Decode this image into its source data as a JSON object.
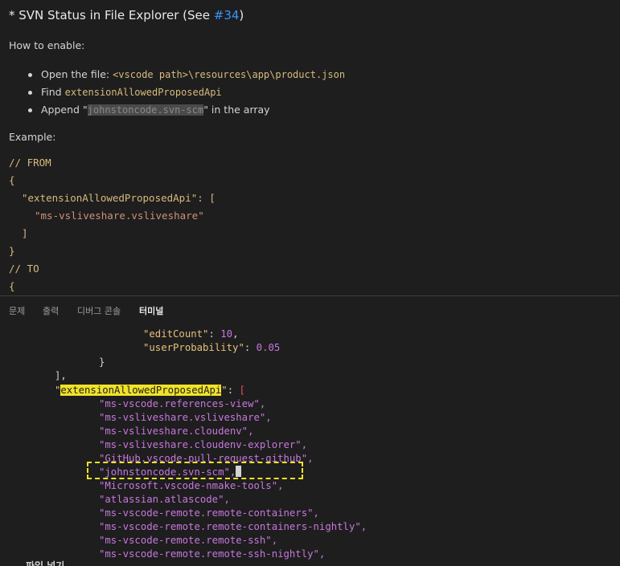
{
  "preview": {
    "heading_prefix": "* SVN Status in File Explorer (See ",
    "heading_link": "#34",
    "heading_suffix": ")",
    "how_to_enable": "How to enable:",
    "steps": [
      {
        "text": "Open the file: ",
        "code": "<vscode path>\\resources\\app\\product.json"
      },
      {
        "text": "Find ",
        "code": "extensionAllowedProposedApi"
      },
      {
        "text_before": "Append \"",
        "code": "johnstoncode.svn-scm",
        "text_after": "\" in the array"
      }
    ],
    "example_label": "Example:",
    "code": {
      "from_comment": "// FROM",
      "open_brace": "{",
      "key_line": "\"extensionAllowedProposedApi\": [",
      "value_line": "\"ms-vsliveshare.vsliveshare\"",
      "close_bracket": "]",
      "close_brace": "}",
      "to_comment": "// TO",
      "open_brace2": "{"
    }
  },
  "panel": {
    "tabs": [
      {
        "label": "문제"
      },
      {
        "label": "출력"
      },
      {
        "label": "디버그 콘솔"
      },
      {
        "label": "터미널",
        "active": true
      }
    ],
    "terminal": {
      "edit_count_key": "\"editCount\"",
      "edit_count_value": "10",
      "user_prob_key": "\"userProbability\"",
      "user_prob_value": "0.05",
      "close_brace": "}",
      "close_bracket": "],",
      "api_key": "extensionAllowedProposedApi",
      "api_open": "[",
      "items": [
        "\"ms-vscode.references-view\",",
        "\"ms-vsliveshare.vsliveshare\",",
        "\"ms-vsliveshare.cloudenv\",",
        "\"ms-vsliveshare.cloudenv-explorer\",",
        "\"GitHub.vscode-pull-request-github\",",
        "\"johnstoncode.svn-scm\",",
        "\"Microsoft.vscode-nmake-tools\",",
        "\"atlassian.atlascode\",",
        "\"ms-vscode-remote.remote-containers\",",
        "\"ms-vscode-remote.remote-containers-nightly\",",
        "\"ms-vscode-remote.remote-ssh\",",
        "\"ms-vscode-remote.remote-ssh-nightly\","
      ],
      "bottom_text": "파일 넣기"
    }
  }
}
